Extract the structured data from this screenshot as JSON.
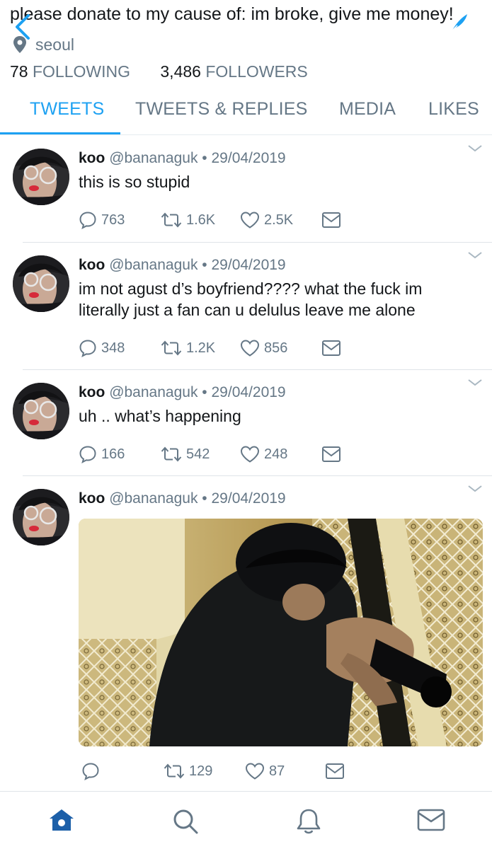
{
  "profile": {
    "bio": "please donate to my cause of: im broke, give me money!",
    "location": "seoul",
    "following_count": "78",
    "following_label": "FOLLOWING",
    "followers_count": "3,486",
    "followers_label": "FOLLOWERS"
  },
  "tabs": [
    {
      "label": "TWEETS",
      "active": true
    },
    {
      "label": "TWEETS & REPLIES",
      "active": false
    },
    {
      "label": "MEDIA",
      "active": false
    },
    {
      "label": "LIKES",
      "active": false
    }
  ],
  "tweets": [
    {
      "name": "koo",
      "handle": "@bananaguk",
      "separator": "•",
      "date": "29/04/2019",
      "text": "this is so stupid",
      "replies": "763",
      "retweets": "1.6K",
      "likes": "2.5K"
    },
    {
      "name": "koo",
      "handle": "@bananaguk",
      "separator": "•",
      "date": "29/04/2019",
      "text": "im not agust d’s boyfriend???? what the fuck im literally just a fan can u delulus leave me alone",
      "replies": "348",
      "retweets": "1.2K",
      "likes": "856"
    },
    {
      "name": "koo",
      "handle": "@bananaguk",
      "separator": "•",
      "date": "29/04/2019",
      "text": "uh .. what’s happening",
      "replies": "166",
      "retweets": "542",
      "likes": "248"
    },
    {
      "name": "koo",
      "handle": "@bananaguk",
      "separator": "•",
      "date": "29/04/2019",
      "text": "",
      "replies": "",
      "retweets": "129",
      "likes": "87",
      "has_media": true
    }
  ],
  "colors": {
    "accent": "#1da1f2",
    "muted": "#657786",
    "nav_icon": "#1c5fa8"
  },
  "nav": [
    "home-icon",
    "search-icon",
    "notifications-icon",
    "messages-icon"
  ]
}
